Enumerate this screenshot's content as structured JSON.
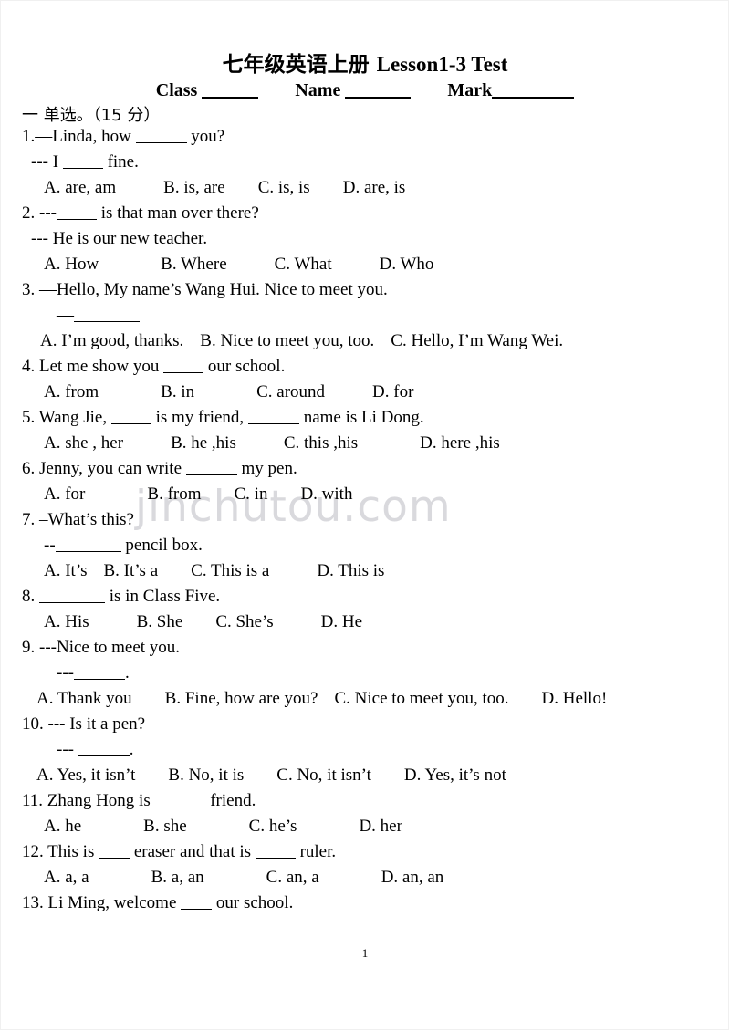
{
  "document": {
    "title_cn": "七年级英语上册 ",
    "title_en": "Lesson1-3 Test",
    "page_number": "1",
    "watermark": "jinchutou.com"
  },
  "meta": {
    "class_label": "Class",
    "name_label": "Name",
    "mark_label": "Mark"
  },
  "section": {
    "heading": "一  单选。（15 分）"
  },
  "questions": [
    {
      "id": "q1",
      "lines": [
        "1.—Linda, how ",
        " you?"
      ],
      "stem_a": "1.—Linda, how",
      "stem_b": "you?",
      "sub": "--- I",
      "sub_b": "fine.",
      "options": [
        "A. are, am",
        "B. is, are",
        "C. is, is",
        "D. are, is"
      ]
    },
    {
      "id": "q2",
      "stem_a": "2. ---",
      "stem_b": "is that man over there?",
      "sub": "--- He is our new teacher.",
      "options": [
        "A. How",
        "B. Where",
        "C. What",
        "D. Who"
      ]
    },
    {
      "id": "q3",
      "stem_a": "3. —Hello, My name’s Wang Hui. Nice to meet you.",
      "sub": "—",
      "options": [
        "A. I’m good, thanks.",
        "B. Nice to meet you, too.",
        "C. Hello, I’m Wang Wei."
      ]
    },
    {
      "id": "q4",
      "stem_a": "4. Let me show you",
      "stem_b": "our school.",
      "options": [
        "A. from",
        "B. in",
        "C. around",
        "D. for"
      ]
    },
    {
      "id": "q5",
      "stem_a": "5. Wang Jie,",
      "stem_b": "is my friend,",
      "stem_c": "name is Li Dong.",
      "options": [
        "A. she , her",
        "B. he ,his",
        "C. this ,his",
        "D. here ,his"
      ]
    },
    {
      "id": "q6",
      "stem_a": "6. Jenny, you can write",
      "stem_b": "my pen.",
      "options": [
        "A. for",
        "B. from",
        "C. in",
        "D. with"
      ]
    },
    {
      "id": "q7",
      "stem_a": "7. –What’s this?",
      "sub": "--",
      "sub_b": "pencil box.",
      "options": [
        "A. It’s",
        "B. It’s a",
        "C. This is a",
        "D. This is"
      ]
    },
    {
      "id": "q8",
      "stem_a": "8.",
      "stem_b": "is in Class Five.",
      "options": [
        "A. His",
        "B. She",
        "C. She’s",
        "D. He"
      ]
    },
    {
      "id": "q9",
      "stem_a": "9. ---Nice to meet you.",
      "sub": "---",
      "sub_b": ".",
      "options": [
        "A. Thank you",
        "B. Fine, how are you?",
        "C. Nice to meet you, too.",
        "D. Hello!"
      ]
    },
    {
      "id": "q10",
      "stem_a": "10. --- Is it a pen?",
      "sub": "---",
      "sub_b": ".",
      "options": [
        "A. Yes, it isn’t",
        "B. No, it is",
        "C. No, it isn’t",
        "D. Yes, it’s not"
      ]
    },
    {
      "id": "q11",
      "stem_a": "11. Zhang Hong is",
      "stem_b": "friend.",
      "options": [
        "A. he",
        "B. she",
        "C. he’s",
        "D. her"
      ]
    },
    {
      "id": "q12",
      "stem_a": "12. This is",
      "stem_b": "eraser and that is",
      "stem_c": "ruler.",
      "options": [
        "A. a, a",
        "B. a, an",
        "C. an, a",
        "D. an, an"
      ]
    },
    {
      "id": "q13",
      "stem_a": "13. Li Ming, welcome",
      "stem_b": "our school.",
      "options": []
    }
  ]
}
